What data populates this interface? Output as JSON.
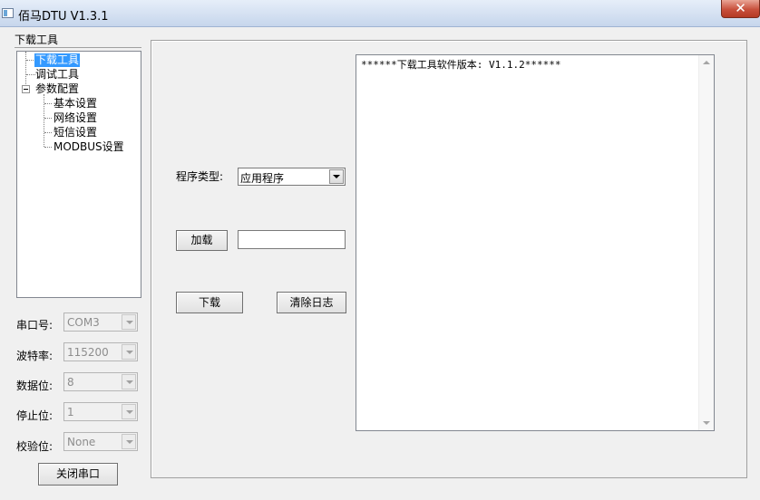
{
  "window": {
    "title": "佰马DTU V1.3.1",
    "close_label": "✕"
  },
  "left": {
    "caption": "下载工具",
    "tree": {
      "download_tool": "下载工具",
      "debug_tool": "调试工具",
      "param_config": "参数配置",
      "basic_settings": "基本设置",
      "network_settings": "网络设置",
      "sms_settings": "短信设置",
      "modbus_settings": "MODBUS设置"
    },
    "serial": {
      "port_label": "串口号:",
      "port_value": "COM3",
      "baud_label": "波特率:",
      "baud_value": "115200",
      "databits_label": "数据位:",
      "databits_value": "8",
      "stopbits_label": "停止位:",
      "stopbits_value": "1",
      "parity_label": "校验位:",
      "parity_value": "None",
      "close_port_button": "关闭串口"
    }
  },
  "main": {
    "program_type_label": "程序类型:",
    "program_type_value": "应用程序",
    "load_button": "加载",
    "file_path_value": "",
    "download_button": "下载",
    "clear_log_button": "清除日志",
    "log_text": "******下载工具软件版本: V1.1.2******"
  }
}
